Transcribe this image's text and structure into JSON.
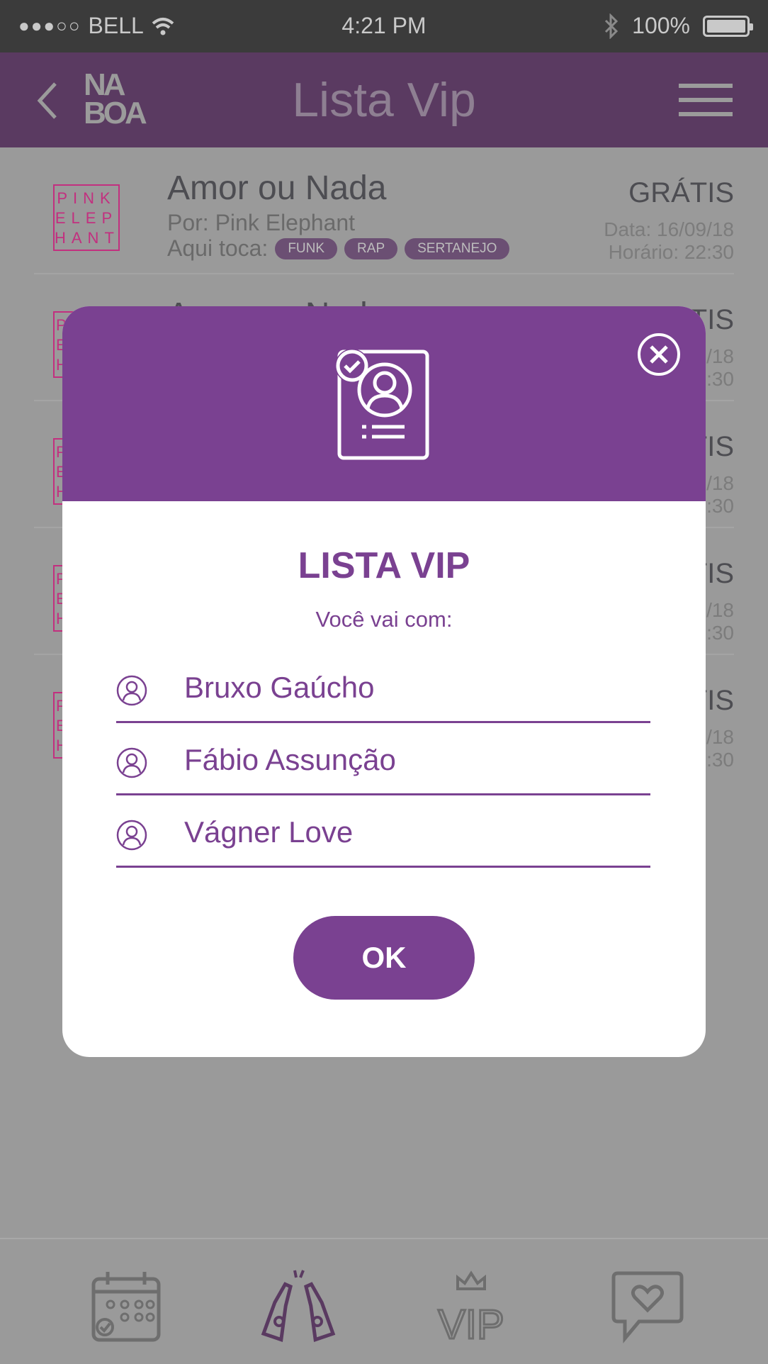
{
  "status_bar": {
    "signal_dots": "●●●○○",
    "carrier": "BELL",
    "time": "4:21 PM",
    "battery": "100%",
    "battery_level": 1.0,
    "icons": [
      "wifi-icon",
      "bluetooth-icon",
      "battery-icon"
    ]
  },
  "header": {
    "title": "Lista Vip",
    "logo_text_top": "NA",
    "logo_text_bottom": "BOA",
    "back_icon": "chevron-left-icon",
    "menu_icon": "hamburger-icon"
  },
  "events": [
    {
      "logo_lines": [
        "PINK",
        "ELEP",
        "HANT"
      ],
      "title": "Amor ou Nada",
      "by": "Por: Pink Elephant",
      "plays_label": "Aqui toca:",
      "tags": [
        "FUNK",
        "RAP",
        "SERTANEJO"
      ],
      "price": "GRÁTIS",
      "date": "Data: 16/09/18",
      "time": "Horário: 22:30"
    },
    {
      "logo_lines": [
        "P",
        "E",
        "H"
      ],
      "title": "Amor ou Nada",
      "price": "TIS",
      "date": "/18",
      "time": ":30"
    },
    {
      "logo_lines": [
        "P",
        "E",
        "H"
      ],
      "price": "TIS",
      "date": "/18",
      "time": ":30"
    },
    {
      "logo_lines": [
        "P",
        "E",
        "H"
      ],
      "price": "TIS",
      "date": "/18",
      "time": ":30"
    },
    {
      "logo_lines": [
        "P",
        "E",
        "H"
      ],
      "price": "TIS",
      "date": "/18",
      "time": ":30"
    }
  ],
  "modal": {
    "title": "LISTA VIP",
    "subtitle": "Você vai com:",
    "guests": [
      "Bruxo Gaúcho",
      "Fábio Assunção",
      "Vágner Love"
    ],
    "ok_label": "OK",
    "header_icon": "vip-list-document-icon",
    "close_icon": "close-circle-icon",
    "guest_icon": "user-circle-icon",
    "accent_color": "#7a4191"
  },
  "tab_bar": {
    "tabs": [
      {
        "name": "calendar-icon",
        "active": false
      },
      {
        "name": "beer-bottles-icon",
        "active": true
      },
      {
        "name": "vip-crown-icon",
        "active": false
      },
      {
        "name": "heart-chat-icon",
        "active": false
      }
    ]
  },
  "colors": {
    "primary": "#7a4191",
    "header_bg": "#5a3a61",
    "overlay_bg": "#9a9a9a",
    "status_bg": "#3b3b3b"
  }
}
